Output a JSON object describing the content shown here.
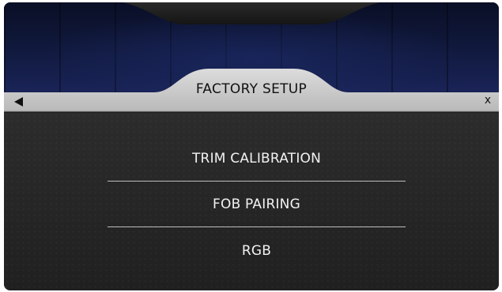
{
  "header": {
    "title": "FACTORY SETUP",
    "close_label": "x",
    "back_icon": "back-arrow-icon"
  },
  "menu": {
    "items": [
      {
        "label": "TRIM CALIBRATION"
      },
      {
        "label": "FOB PAIRING"
      },
      {
        "label": "RGB"
      }
    ]
  },
  "colors": {
    "header_bar": "#c9c9c9",
    "menu_text": "#f2f2f2",
    "background": "#262626",
    "top_area": "#111a3f"
  }
}
